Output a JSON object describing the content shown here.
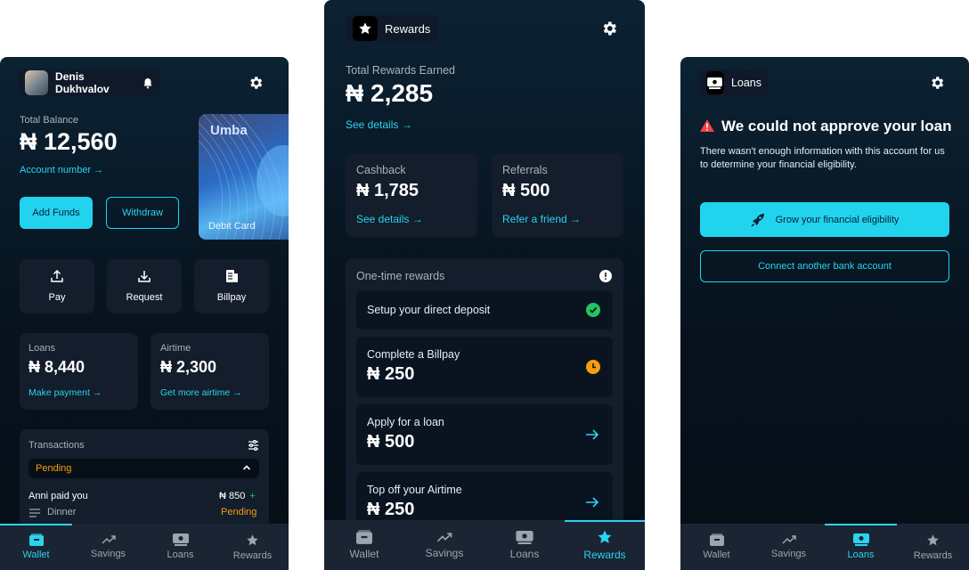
{
  "wallet": {
    "user_name": "Denis Dukhvalov",
    "total_balance_label": "Total Balance",
    "total_balance": "₦ 12,560",
    "account_number_link": "Account number →",
    "add_funds": "Add Funds",
    "withdraw": "Withdraw",
    "card_brand": "Umba",
    "card_label": "Debit Card",
    "actions": [
      {
        "label": "Pay",
        "icon": "upload-icon"
      },
      {
        "label": "Request",
        "icon": "download-icon"
      },
      {
        "label": "Billpay",
        "icon": "receipt-icon"
      }
    ],
    "loans": {
      "label": "Loans",
      "amount": "₦ 8,440",
      "link": "Make payment →"
    },
    "airtime": {
      "label": "Airtime",
      "amount": "₦ 2,300",
      "link": "Get more airtime →"
    },
    "transactions": {
      "title": "Transactions",
      "filter": "Pending",
      "item_title": "Anni paid you",
      "item_amount": "₦ 850",
      "item_sign": "+",
      "item_note": "Dinner",
      "item_status": "Pending"
    }
  },
  "rewards": {
    "title": "Rewards",
    "total_label": "Total Rewards Earned",
    "total": "₦ 2,285",
    "see_details": "See details →",
    "cashback": {
      "label": "Cashback",
      "amount": "₦ 1,785",
      "link": "See details →"
    },
    "referrals": {
      "label": "Referrals",
      "amount": "₦ 500",
      "link": "Refer a friend →"
    },
    "one_time_title": "One-time rewards",
    "items": [
      {
        "title": "Setup your direct deposit",
        "amount": "",
        "status": "check-icon"
      },
      {
        "title": "Complete a Billpay",
        "amount": "₦ 250",
        "status": "clock-icon"
      },
      {
        "title": "Apply for a loan",
        "amount": "₦ 500",
        "status": "arrow-right-icon"
      },
      {
        "title": "Top off your Airtime",
        "amount": "₦ 250",
        "status": "arrow-right-icon"
      }
    ]
  },
  "loans": {
    "title": "Loans",
    "error_title": "We could not approve your loan",
    "error_body": "There wasn't enough information with this account for us to determine your financial eligibility.",
    "grow_button": "Grow your financial eligibility",
    "connect_button": "Connect another bank account"
  },
  "tabs": [
    "Wallet",
    "Savings",
    "Loans",
    "Rewards"
  ],
  "colors": {
    "accent": "#22d3ee",
    "background": "#07121d",
    "card": "#131d2b",
    "pending": "#f59e0b",
    "success": "#22c55e",
    "error": "#ef4444"
  }
}
